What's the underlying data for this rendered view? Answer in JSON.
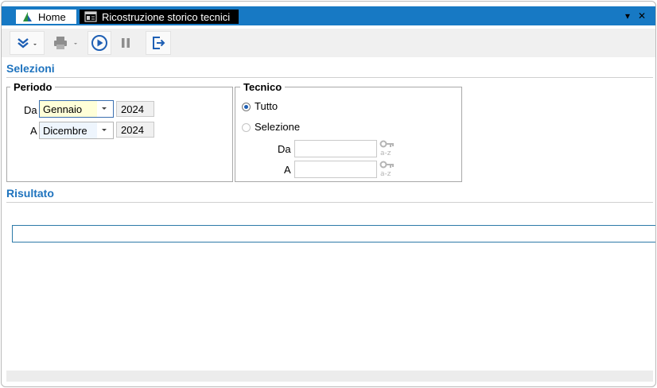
{
  "tabs": {
    "home_label": "Home",
    "active_label": "Ricostruzione storico tecnici",
    "pin_glyph": "▾",
    "close_glyph": "✕"
  },
  "toolbar": {
    "buttons": [
      "expand-menu-icon",
      "print-icon",
      "play-icon",
      "pause-icon",
      "exit-icon"
    ]
  },
  "selezioni": {
    "title": "Selezioni"
  },
  "periodo": {
    "legend": "Periodo",
    "da_label": "Da",
    "da_month": "Gennaio",
    "da_year": "2024",
    "a_label": "A",
    "a_month": "Dicembre",
    "a_year": "2024"
  },
  "tecnico": {
    "legend": "Tecnico",
    "option_tutto": "Tutto",
    "option_selezione": "Selezione",
    "da_label": "Da",
    "a_label": "A",
    "da_value": "",
    "a_value": "",
    "selected": "Tutto"
  },
  "risultato": {
    "title": "Risultato",
    "value": ""
  },
  "colors": {
    "accent": "#1779c4",
    "section_title": "#1e73be"
  }
}
